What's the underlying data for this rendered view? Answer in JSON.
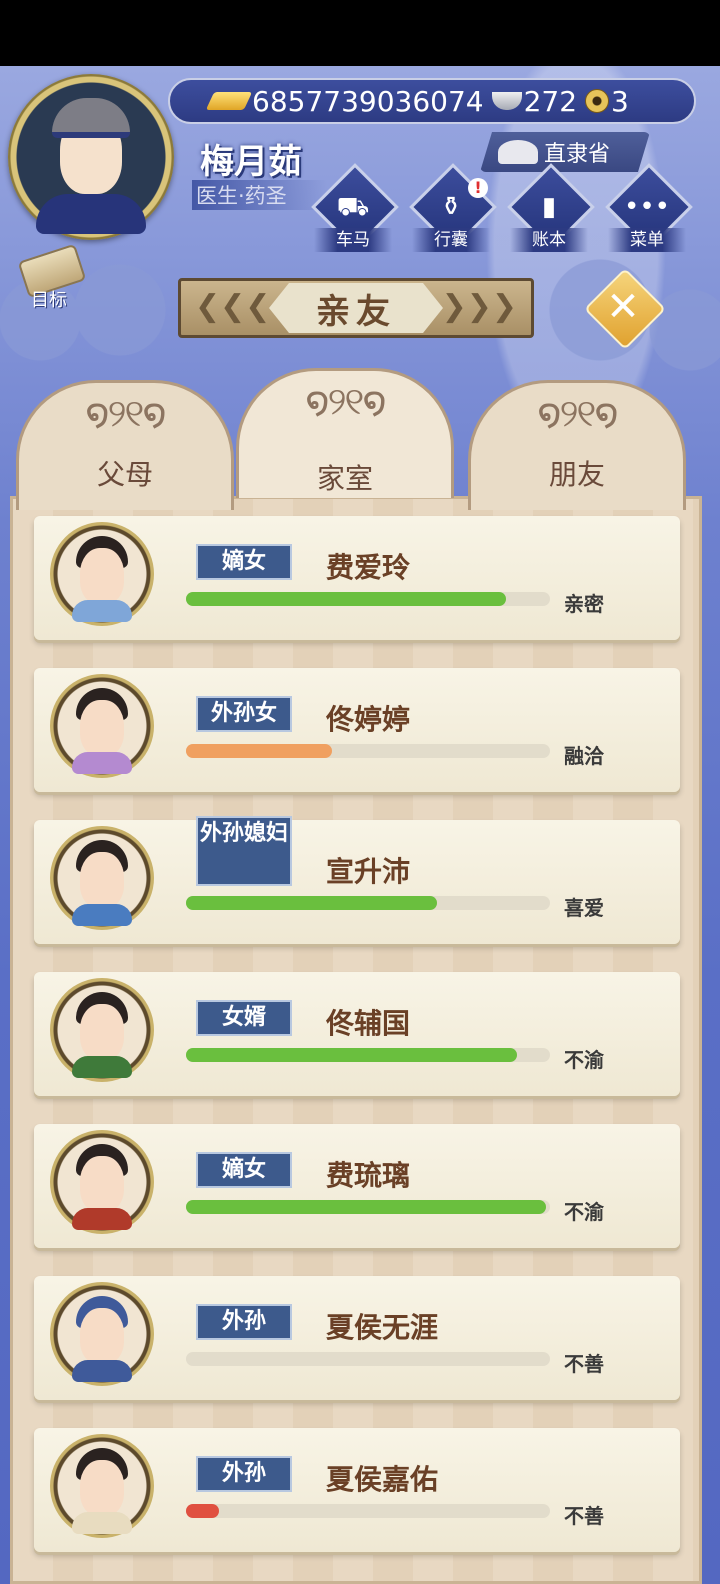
{
  "player": {
    "name": "梅月茹",
    "title": "医生·药圣",
    "location": "直隶省"
  },
  "currency": {
    "gold": "6857739036074",
    "silver": "272",
    "coins": "3"
  },
  "menu": {
    "carriage": "车马",
    "bag": "行囊",
    "ledger": "账本",
    "menu": "菜单",
    "bag_badge": "!"
  },
  "goal": {
    "label": "目标"
  },
  "panel": {
    "title": "亲友"
  },
  "tabs": [
    {
      "label": "父母"
    },
    {
      "label": "家室"
    },
    {
      "label": "朋友"
    }
  ],
  "relatives": [
    {
      "relation": "嫡女",
      "name": "费爱玲",
      "status": "亲密",
      "affinity": 0.88,
      "bar_color": "#6abf3e"
    },
    {
      "relation": "外孙女",
      "name": "佟婷婷",
      "status": "融洽",
      "affinity": 0.4,
      "bar_color": "#f0a060"
    },
    {
      "relation": "外孙媳妇",
      "name": "宣升沛",
      "status": "喜爱",
      "affinity": 0.69,
      "bar_color": "#6abf3e"
    },
    {
      "relation": "女婿",
      "name": "佟辅国",
      "status": "不渝",
      "affinity": 0.91,
      "bar_color": "#6abf3e"
    },
    {
      "relation": "嫡女",
      "name": "费琉璃",
      "status": "不渝",
      "affinity": 0.99,
      "bar_color": "#6abf3e"
    },
    {
      "relation": "外孙",
      "name": "夏侯无涯",
      "status": "不善",
      "affinity": 0.0,
      "bar_color": "#e05040"
    },
    {
      "relation": "外孙",
      "name": "夏侯嘉佑",
      "status": "不善",
      "affinity": 0.09,
      "bar_color": "#e05040"
    }
  ]
}
